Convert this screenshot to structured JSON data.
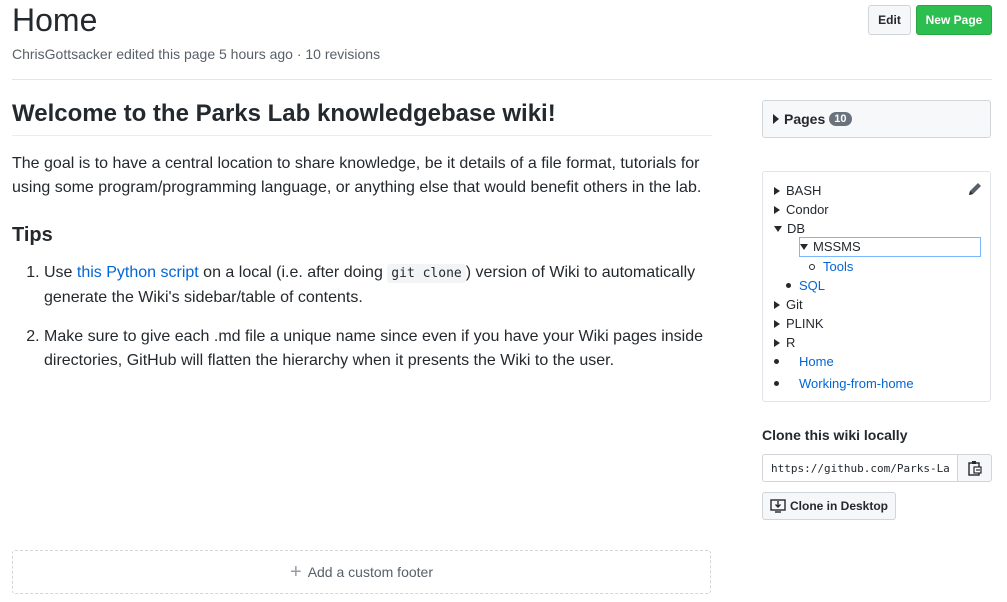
{
  "header": {
    "title": "Home",
    "meta": "ChrisGottsacker edited this page 5 hours ago · 10 revisions",
    "edit_label": "Edit",
    "new_page_label": "New Page"
  },
  "content": {
    "heading": "Welcome to the Parks Lab knowledgebase wiki!",
    "intro": "The goal is to have a central location to share knowledge, be it details of a file format, tutorials for using some program/programming language, or anything else that would benefit others in the lab.",
    "tips_heading": "Tips",
    "tip1_before": "Use ",
    "tip1_link": "this Python script",
    "tip1_middle": " on a local (i.e. after doing ",
    "tip1_code": "git clone",
    "tip1_after": ") version of Wiki to automatically generate the Wiki's sidebar/table of contents.",
    "tip2": "Make sure to give each .md file a unique name since even if you have your Wiki pages inside directories, GitHub will flatten the hierarchy when it presents the Wiki to the user."
  },
  "footer": {
    "add_label": "Add a custom footer"
  },
  "sidebar": {
    "pages_label": "Pages",
    "pages_count": "10",
    "toc": {
      "bash": "BASH",
      "condor": "Condor",
      "db": "DB",
      "mssms": "MSSMS",
      "tools": "Tools",
      "sql": "SQL",
      "git": "Git",
      "plink": "PLINK",
      "r": "R",
      "home": "Home",
      "wfh": "Working-from-home"
    },
    "clone_title": "Clone this wiki locally",
    "clone_url": "https://github.com/Parks-La",
    "clone_desktop_label": "Clone in Desktop"
  }
}
